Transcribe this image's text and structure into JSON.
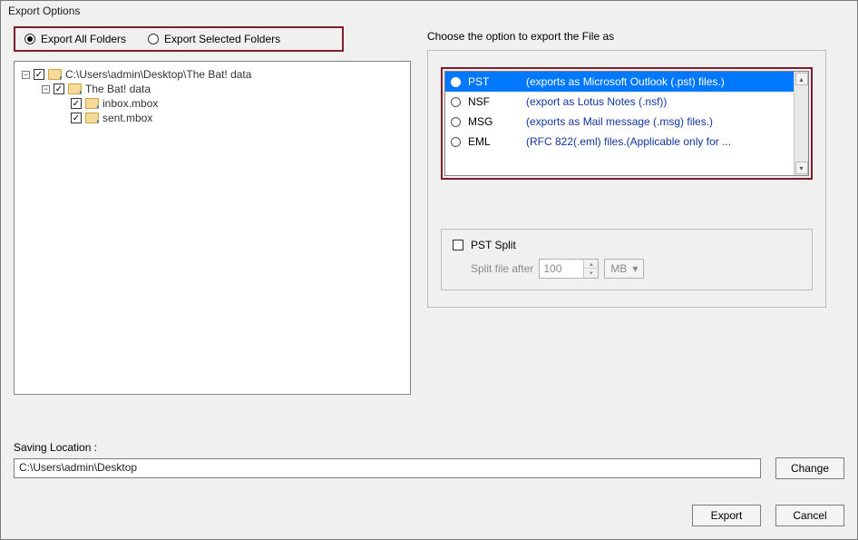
{
  "window": {
    "title": "Export Options"
  },
  "scope": {
    "all_label": "Export All Folders",
    "selected_label": "Export Selected Folders",
    "selected_value": "all"
  },
  "tree": {
    "items": [
      {
        "level": 1,
        "expander": "−",
        "checked": true,
        "label": "C:\\Users\\admin\\Desktop\\The Bat! data"
      },
      {
        "level": 2,
        "expander": "−",
        "checked": true,
        "label": "The Bat! data"
      },
      {
        "level": 3,
        "expander": "",
        "checked": true,
        "label": "inbox.mbox"
      },
      {
        "level": 3,
        "expander": "",
        "checked": true,
        "label": "sent.mbox"
      }
    ]
  },
  "formats": {
    "group_label": "Choose the option to export the File as",
    "selected": "PST",
    "options": [
      {
        "name": "PST",
        "desc": "(exports as Microsoft Outlook (.pst) files.)"
      },
      {
        "name": "NSF",
        "desc": "(export as Lotus Notes (.nsf))"
      },
      {
        "name": "MSG",
        "desc": "(exports as Mail message (.msg) files.)"
      },
      {
        "name": "EML",
        "desc": "(RFC 822(.eml) files.(Applicable only for ..."
      }
    ]
  },
  "split": {
    "label": "PST Split",
    "checked": false,
    "after_label": "Split file after",
    "value": "100",
    "unit": "MB"
  },
  "location": {
    "label": "Saving Location :",
    "path": "C:\\Users\\admin\\Desktop",
    "change_label": "Change"
  },
  "actions": {
    "export_label": "Export",
    "cancel_label": "Cancel"
  }
}
